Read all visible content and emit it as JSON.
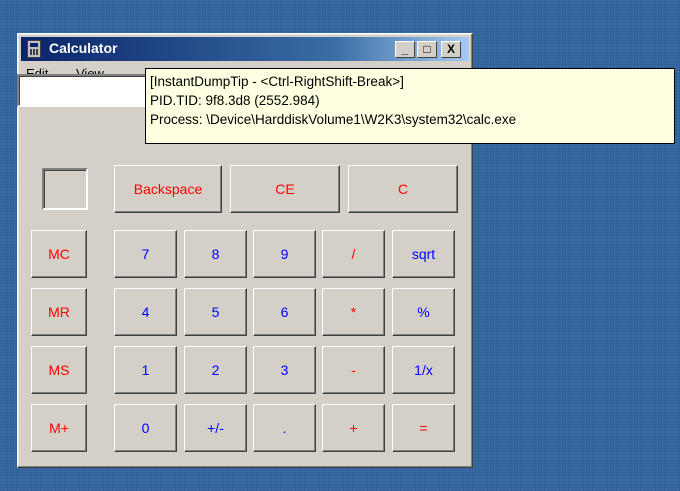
{
  "window": {
    "title": "Calculator",
    "controls": {
      "minimize": "_",
      "maximize": "□",
      "close": "X"
    }
  },
  "menu": {
    "edit": "Edit",
    "view": "View"
  },
  "tooltip": {
    "line1": "[InstantDumpTip - <Ctrl-RightShift-Break>]",
    "line2": "PID.TID: 9f8.3d8 (2552.984)",
    "line3": "Process: \\Device\\HarddiskVolume1\\W2K3\\system32\\calc.exe"
  },
  "buttons": {
    "backspace": "Backspace",
    "ce": "CE",
    "c": "C",
    "mc": "MC",
    "mr": "MR",
    "ms": "MS",
    "mplus": "M+",
    "n7": "7",
    "n8": "8",
    "n9": "9",
    "div": "/",
    "sqrt": "sqrt",
    "n4": "4",
    "n5": "5",
    "n6": "6",
    "mul": "*",
    "pct": "%",
    "n1": "1",
    "n2": "2",
    "n3": "3",
    "sub": "-",
    "recip": "1/x",
    "n0": "0",
    "sign": "+/-",
    "dot": ".",
    "add": "+",
    "eq": "="
  },
  "colors": {
    "red_text": "#ff0000",
    "blue_text": "#0000ff",
    "desktop": "#3a6ea5",
    "titlebar": "#0a246a"
  }
}
